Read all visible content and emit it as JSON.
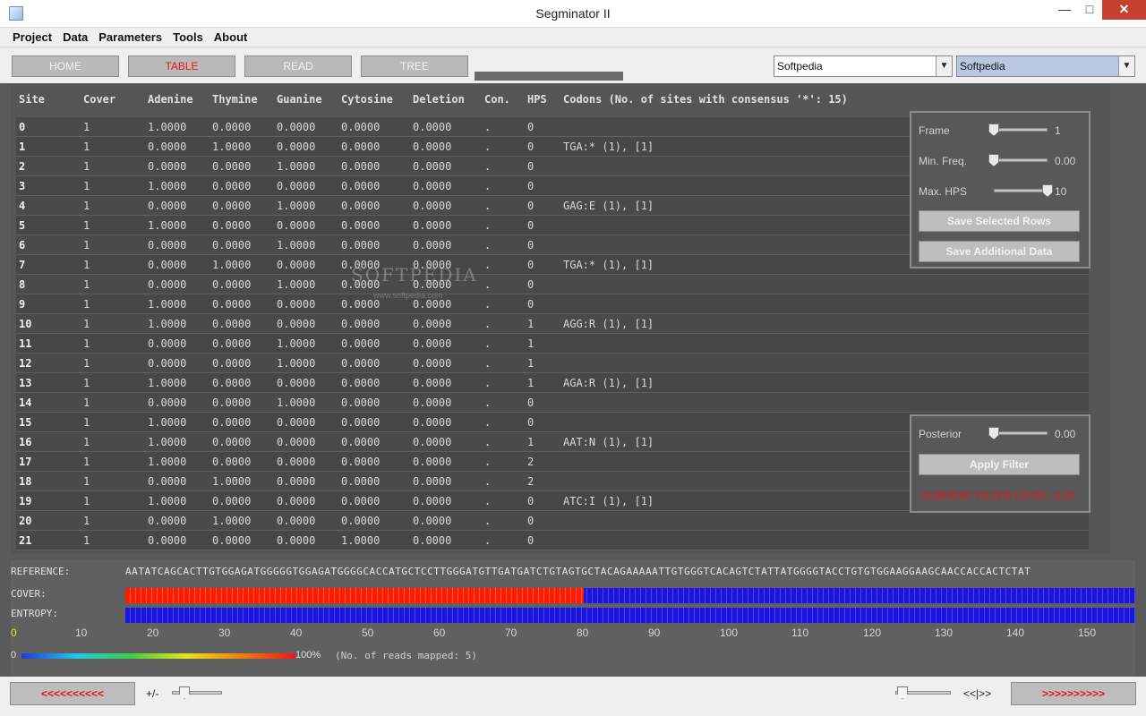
{
  "window": {
    "title": "Segminator II"
  },
  "menu": [
    "Project",
    "Data",
    "Parameters",
    "Tools",
    "About"
  ],
  "nav": {
    "home": "HOME",
    "table": "TABLE",
    "read": "READ",
    "tree": "TREE"
  },
  "combos": {
    "left": "Softpedia",
    "right": "Softpedia"
  },
  "table": {
    "headers": [
      "Site",
      "Cover",
      "Adenine",
      "Thymine",
      "Guanine",
      "Cytosine",
      "Deletion",
      "Con.",
      "HPS"
    ],
    "codons_header": "Codons (No. of sites with consensus '*': 15)",
    "rows": [
      {
        "site": "0",
        "cover": "1",
        "a": "1.0000",
        "t": "0.0000",
        "g": "0.0000",
        "c": "0.0000",
        "del": "0.0000",
        "con": ".",
        "hps": "0",
        "codon": ""
      },
      {
        "site": "1",
        "cover": "1",
        "a": "0.0000",
        "t": "1.0000",
        "g": "0.0000",
        "c": "0.0000",
        "del": "0.0000",
        "con": ".",
        "hps": "0",
        "codon": "TGA:* (1),  [1]"
      },
      {
        "site": "2",
        "cover": "1",
        "a": "0.0000",
        "t": "0.0000",
        "g": "1.0000",
        "c": "0.0000",
        "del": "0.0000",
        "con": ".",
        "hps": "0",
        "codon": ""
      },
      {
        "site": "3",
        "cover": "1",
        "a": "1.0000",
        "t": "0.0000",
        "g": "0.0000",
        "c": "0.0000",
        "del": "0.0000",
        "con": ".",
        "hps": "0",
        "codon": ""
      },
      {
        "site": "4",
        "cover": "1",
        "a": "0.0000",
        "t": "0.0000",
        "g": "1.0000",
        "c": "0.0000",
        "del": "0.0000",
        "con": ".",
        "hps": "0",
        "codon": "GAG:E (1),  [1]"
      },
      {
        "site": "5",
        "cover": "1",
        "a": "1.0000",
        "t": "0.0000",
        "g": "0.0000",
        "c": "0.0000",
        "del": "0.0000",
        "con": ".",
        "hps": "0",
        "codon": ""
      },
      {
        "site": "6",
        "cover": "1",
        "a": "0.0000",
        "t": "0.0000",
        "g": "1.0000",
        "c": "0.0000",
        "del": "0.0000",
        "con": ".",
        "hps": "0",
        "codon": ""
      },
      {
        "site": "7",
        "cover": "1",
        "a": "0.0000",
        "t": "1.0000",
        "g": "0.0000",
        "c": "0.0000",
        "del": "0.0000",
        "con": ".",
        "hps": "0",
        "codon": "TGA:* (1),  [1]"
      },
      {
        "site": "8",
        "cover": "1",
        "a": "0.0000",
        "t": "0.0000",
        "g": "1.0000",
        "c": "0.0000",
        "del": "0.0000",
        "con": ".",
        "hps": "0",
        "codon": ""
      },
      {
        "site": "9",
        "cover": "1",
        "a": "1.0000",
        "t": "0.0000",
        "g": "0.0000",
        "c": "0.0000",
        "del": "0.0000",
        "con": ".",
        "hps": "0",
        "codon": ""
      },
      {
        "site": "10",
        "cover": "1",
        "a": "1.0000",
        "t": "0.0000",
        "g": "0.0000",
        "c": "0.0000",
        "del": "0.0000",
        "con": ".",
        "hps": "1",
        "codon": "AGG:R (1),  [1]"
      },
      {
        "site": "11",
        "cover": "1",
        "a": "0.0000",
        "t": "0.0000",
        "g": "1.0000",
        "c": "0.0000",
        "del": "0.0000",
        "con": ".",
        "hps": "1",
        "codon": ""
      },
      {
        "site": "12",
        "cover": "1",
        "a": "0.0000",
        "t": "0.0000",
        "g": "1.0000",
        "c": "0.0000",
        "del": "0.0000",
        "con": ".",
        "hps": "1",
        "codon": ""
      },
      {
        "site": "13",
        "cover": "1",
        "a": "1.0000",
        "t": "0.0000",
        "g": "0.0000",
        "c": "0.0000",
        "del": "0.0000",
        "con": ".",
        "hps": "1",
        "codon": "AGA:R (1),  [1]"
      },
      {
        "site": "14",
        "cover": "1",
        "a": "0.0000",
        "t": "0.0000",
        "g": "1.0000",
        "c": "0.0000",
        "del": "0.0000",
        "con": ".",
        "hps": "0",
        "codon": ""
      },
      {
        "site": "15",
        "cover": "1",
        "a": "1.0000",
        "t": "0.0000",
        "g": "0.0000",
        "c": "0.0000",
        "del": "0.0000",
        "con": ".",
        "hps": "0",
        "codon": ""
      },
      {
        "site": "16",
        "cover": "1",
        "a": "1.0000",
        "t": "0.0000",
        "g": "0.0000",
        "c": "0.0000",
        "del": "0.0000",
        "con": ".",
        "hps": "1",
        "codon": "AAT:N (1),  [1]"
      },
      {
        "site": "17",
        "cover": "1",
        "a": "1.0000",
        "t": "0.0000",
        "g": "0.0000",
        "c": "0.0000",
        "del": "0.0000",
        "con": ".",
        "hps": "2",
        "codon": ""
      },
      {
        "site": "18",
        "cover": "1",
        "a": "0.0000",
        "t": "1.0000",
        "g": "0.0000",
        "c": "0.0000",
        "del": "0.0000",
        "con": ".",
        "hps": "2",
        "codon": ""
      },
      {
        "site": "19",
        "cover": "1",
        "a": "1.0000",
        "t": "0.0000",
        "g": "0.0000",
        "c": "0.0000",
        "del": "0.0000",
        "con": ".",
        "hps": "0",
        "codon": "ATC:I (1),  [1]"
      },
      {
        "site": "20",
        "cover": "1",
        "a": "0.0000",
        "t": "1.0000",
        "g": "0.0000",
        "c": "0.0000",
        "del": "0.0000",
        "con": ".",
        "hps": "0",
        "codon": ""
      },
      {
        "site": "21",
        "cover": "1",
        "a": "0.0000",
        "t": "0.0000",
        "g": "0.0000",
        "c": "1.0000",
        "del": "0.0000",
        "con": ".",
        "hps": "0",
        "codon": ""
      }
    ]
  },
  "frame_panel": {
    "frame_label": "Frame",
    "frame_value": "1",
    "frame_level": 0,
    "minfreq_label": "Min. Freq.",
    "minfreq_value": "0.00",
    "minfreq_level": 0,
    "maxhps_label": "Max. HPS",
    "maxhps_value": "10",
    "maxhps_level": 1,
    "save_rows": "Save Selected Rows",
    "save_additional": "Save Additional Data"
  },
  "filter_panel": {
    "posterior_label": "Posterior",
    "posterior_value": "0.00",
    "posterior_level": 0,
    "apply": "Apply Filter",
    "current": "CURRENT FILTER LEVEL: 0.00"
  },
  "watermark": {
    "main": "SOFTPEDIA",
    "sub": "www.softpedia.com"
  },
  "sequence": {
    "reference_label": "REFERENCE:",
    "reference": "AATATCAGCACTTGTGGAGATGGGGGTGGAGATGGGGCACCATGCTCCTTGGGATGTTGATGATCTGTAGTGCTACAGAAAAATTGTGGGTCACAGTCTATTATGGGGTACCTGTGTGGAAGGAAGCAACCACCACTCTAT",
    "cover_label": "COVER:",
    "entropy_label": "ENTROPY:",
    "ticks": [
      "0",
      "10",
      "20",
      "30",
      "40",
      "50",
      "60",
      "70",
      "80",
      "90",
      "100",
      "110",
      "120",
      "130",
      "140",
      "150"
    ],
    "legend_min": "0",
    "legend_max": "100%",
    "reads_info": "(No. of reads mapped: 5)",
    "colors": {
      "high": "#ff1a00",
      "low": "#1c15e0"
    }
  },
  "bottom": {
    "prev": "<<<<<<<<<<",
    "next": ">>>>>>>>>>",
    "plusminus": "+/-",
    "step": "<<|>>"
  },
  "colors": {
    "accent_red": "#e8141b",
    "panel_bg": "#555555"
  }
}
